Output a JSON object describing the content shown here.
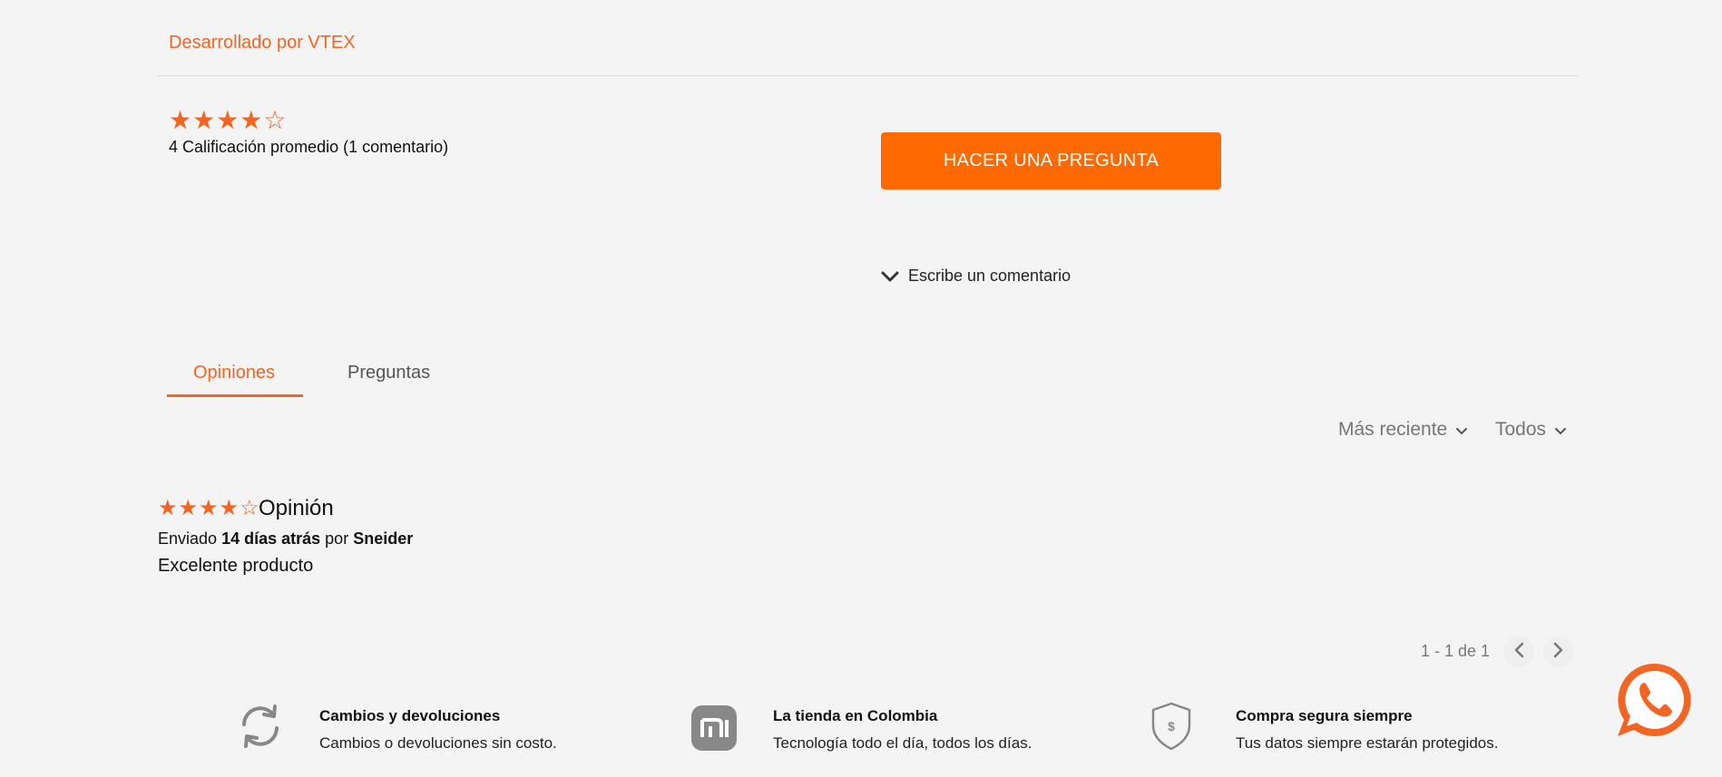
{
  "developer_link": "Desarrollado por VTEX",
  "rating_summary": {
    "stars": "★★★★☆",
    "text": "4 Calificación promedio (1 comentario)"
  },
  "ask_button": "HACER UNA PREGUNTA",
  "write_comment": "Escribe un comentario",
  "tabs": [
    {
      "label": "Opiniones",
      "active": true
    },
    {
      "label": "Preguntas",
      "active": false
    }
  ],
  "sort": {
    "order": "Más reciente",
    "filter": "Todos"
  },
  "review": {
    "stars": "★★★★☆",
    "title": "Opinión",
    "meta_prefix": "Enviado",
    "meta_time": "14 días atrás",
    "meta_by": "por",
    "author": "Sneider",
    "body": "Excelente producto"
  },
  "pagination": {
    "text": "1 - 1 de 1"
  },
  "features": [
    {
      "icon": "refresh-icon",
      "title": "Cambios y devoluciones",
      "desc": "Cambios o devoluciones sin costo."
    },
    {
      "icon": "mi-logo-icon",
      "title": "La tienda en Colombia",
      "desc": "Tecnología todo el día, todos los días."
    },
    {
      "icon": "shield-dollar-icon",
      "title": "Compra segura siempre",
      "desc": "Tus datos siempre estarán protegidos."
    }
  ],
  "colors": {
    "accent": "#f26522",
    "button": "#ff6900",
    "background": "#f4f4f4"
  }
}
